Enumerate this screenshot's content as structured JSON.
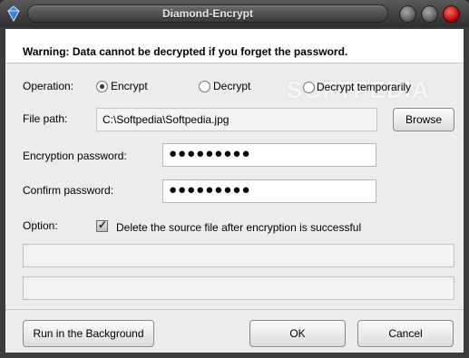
{
  "window": {
    "title": "Diamond-Encrypt"
  },
  "warning": "Warning: Data cannot be decrypted if you forget the password.",
  "operation": {
    "label": "Operation:",
    "options": [
      "Encrypt",
      "Decrypt",
      "Decrypt temporarily"
    ],
    "selected": "Encrypt"
  },
  "file": {
    "label": "File path:",
    "value": "C:\\Softpedia\\Softpedia.jpg",
    "browse_label": "Browse"
  },
  "encryption_password": {
    "label": "Encryption password:",
    "masked_value": "●●●●●●●●●"
  },
  "confirm_password": {
    "label": "Confirm password:",
    "masked_value": "●●●●●●●●●"
  },
  "option": {
    "label": "Option:",
    "checkbox_label": "Delete the source file after encryption is successful",
    "checked": true
  },
  "progress": {
    "bar1_fraction": 0,
    "bar2_fraction": 0
  },
  "buttons": {
    "background": "Run in the Background",
    "ok": "OK",
    "cancel": "Cancel"
  },
  "watermark": "SOFTPEDIA",
  "colors": {
    "close_button": "#d00000",
    "titlebar": "#3a3a3a"
  }
}
